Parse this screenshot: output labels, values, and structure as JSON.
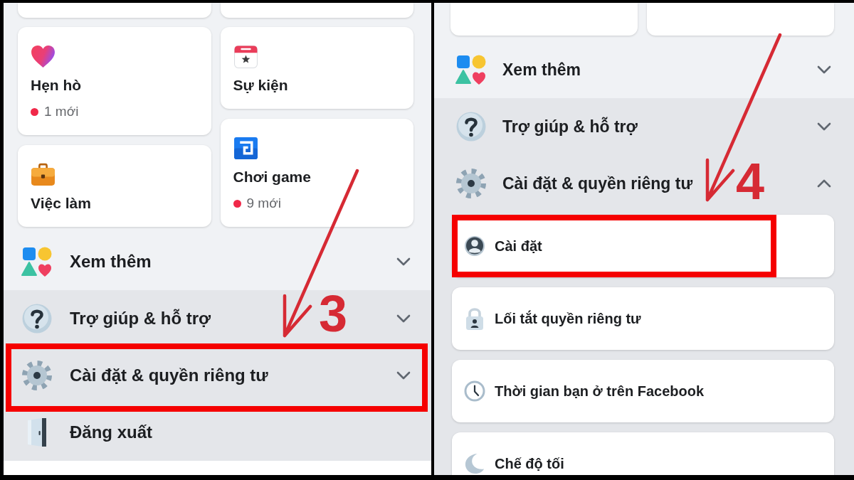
{
  "panels": [
    {
      "shortcut_columns": [
        [
          {
            "title": "Hẹn hò",
            "badge": "1 mới"
          },
          {
            "title": "Việc làm"
          }
        ],
        [
          {
            "title": "Sự kiện"
          },
          {
            "title": "Chơi game",
            "badge": "9 mới"
          }
        ]
      ],
      "menu_rows": [
        {
          "label": "Xem thêm",
          "expanded": false,
          "highlighted": false
        },
        {
          "label": "Trợ giúp & hỗ trợ",
          "expanded": false,
          "highlighted": false
        },
        {
          "label": "Cài đặt & quyền riêng tư",
          "expanded": false,
          "highlighted": true
        },
        {
          "label": "Đăng xuất",
          "highlighted": false
        }
      ],
      "step_number": "3"
    },
    {
      "menu_rows": [
        {
          "label": "Xem thêm",
          "expanded": false,
          "highlighted": false
        },
        {
          "label": "Trợ giúp & hỗ trợ",
          "expanded": false,
          "highlighted": false
        },
        {
          "label": "Cài đặt & quyền riêng tư",
          "expanded": true,
          "highlighted": false,
          "children": [
            {
              "label": "Cài đặt",
              "highlighted": true
            },
            {
              "label": "Lối tắt quyền riêng tư",
              "highlighted": false
            },
            {
              "label": "Thời gian bạn ở trên Facebook",
              "highlighted": false
            },
            {
              "label": "Chế độ tối",
              "highlighted": false
            }
          ]
        }
      ],
      "step_number": "4"
    }
  ]
}
